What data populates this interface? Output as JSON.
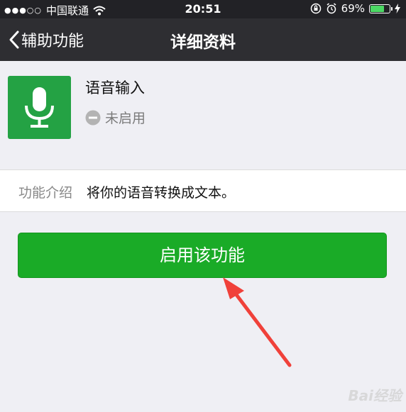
{
  "status_bar": {
    "signal_dots": "●●●○○",
    "carrier": "中国联通",
    "time": "20:51",
    "battery": "69%",
    "battery_level": 0.69
  },
  "nav": {
    "back_label": "辅助功能",
    "title": "详细资料"
  },
  "profile": {
    "name": "语音输入",
    "status": "未启用",
    "icon": "microphone-icon",
    "icon_bg": "#24a244"
  },
  "info": {
    "label": "功能介绍",
    "value": "将你的语音转换成文本。"
  },
  "action": {
    "enable_label": "启用该功能",
    "color": "#1aab27"
  },
  "watermark": "Bai经验",
  "annotation_color": "#f0413a"
}
